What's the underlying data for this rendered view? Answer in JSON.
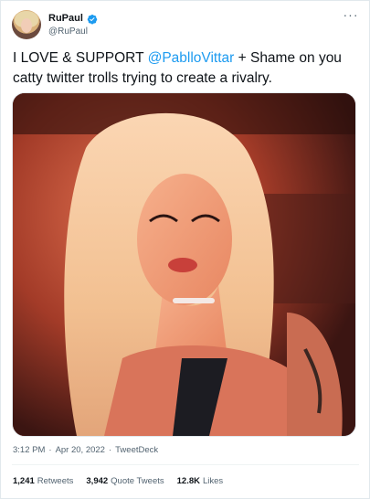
{
  "author": {
    "name": "RuPaul",
    "handle": "@RuPaul",
    "verified": true
  },
  "tweet": {
    "text_before": "I LOVE & SUPPORT ",
    "mention": "@PablloVittar",
    "text_after": " + Shame on you catty twitter trolls trying to create a rivalry."
  },
  "meta": {
    "time": "3:12 PM",
    "separator1": "·",
    "date": "Apr 20, 2022",
    "separator2": "·",
    "source": "TweetDeck"
  },
  "stats": {
    "retweets_count": "1,241",
    "retweets_label": "Retweets",
    "quotes_count": "3,942",
    "quotes_label": "Quote Tweets",
    "likes_count": "12.8K",
    "likes_label": "Likes"
  },
  "colors": {
    "link": "#1d9bf0",
    "verified": "#1d9bf0",
    "secondary_text": "#536471"
  },
  "icons": {
    "verified": "verified-badge-icon",
    "more": "more-horizontal-icon"
  }
}
